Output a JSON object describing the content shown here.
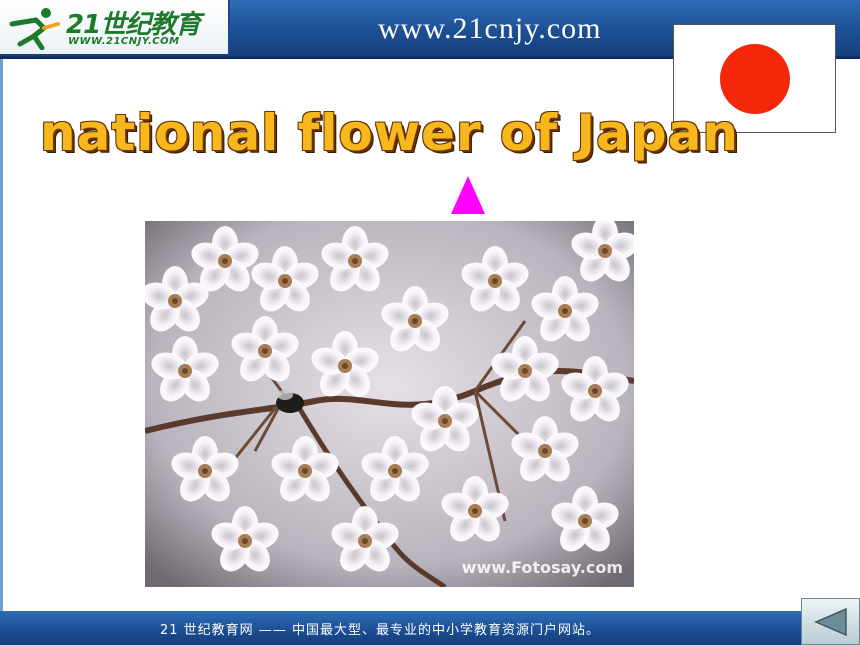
{
  "header": {
    "logo_text": "21世纪教育",
    "logo_subtext": "WWW.21CNJY.COM",
    "site_url": "www.21cnjy.com"
  },
  "slide": {
    "title": "national flower of Japan",
    "flag_icon": "japan-flag-icon",
    "pointer_icon": "triangle-up-icon",
    "photo_watermark": "www.Fotosay.com",
    "colors": {
      "title_fill": "#f8b81d",
      "title_outline": "#6a3300",
      "pointer": "#ff00ff",
      "flag_sun": "#f5270a"
    }
  },
  "footer": {
    "text": "21 世纪教育网 —— 中国最大型、最专业的中小学教育资源门户网站。",
    "back_icon": "back-arrow-icon"
  }
}
